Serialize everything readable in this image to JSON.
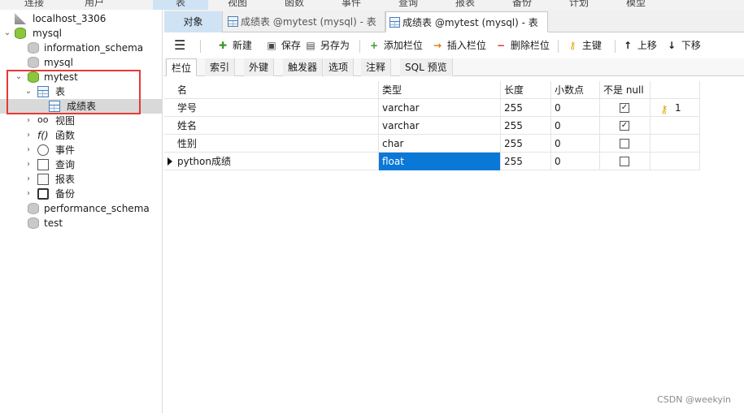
{
  "menu": [
    "连接",
    "用户",
    "表",
    "视图",
    "函数",
    "事件",
    "查询",
    "报表",
    "备份",
    "计划",
    "模型"
  ],
  "tree": {
    "server": "localhost_3306",
    "databases": [
      {
        "name": "mysql"
      },
      {
        "name": "information_schema"
      },
      {
        "name": "mysql"
      },
      {
        "name": "mytest"
      },
      {
        "name": "表"
      },
      {
        "name": "成绩表"
      },
      {
        "name": "视图"
      },
      {
        "name": "函数"
      },
      {
        "name": "事件"
      },
      {
        "name": "查询"
      },
      {
        "name": "报表"
      },
      {
        "name": "备份"
      },
      {
        "name": "performance_schema"
      },
      {
        "name": "test"
      }
    ]
  },
  "tabs": {
    "object": "对象",
    "tab1": "成绩表 @mytest (mysql) - 表",
    "tab2": "成绩表 @mytest (mysql) - 表"
  },
  "toolbar": {
    "new": "新建",
    "save": "保存",
    "save_as": "另存为",
    "add_field": "添加栏位",
    "insert_field": "插入栏位",
    "delete_field": "删除栏位",
    "primary_key": "主键",
    "move_up": "上移",
    "move_down": "下移"
  },
  "subtabs": [
    "栏位",
    "索引",
    "外键",
    "触发器",
    "选项",
    "注释",
    "SQL 预览"
  ],
  "grid": {
    "headers": [
      "名",
      "类型",
      "长度",
      "小数点",
      "不是 null",
      ""
    ],
    "rows": [
      {
        "name": "学号",
        "type": "varchar",
        "length": "255",
        "decimals": "0",
        "not_null": true,
        "key": "1"
      },
      {
        "name": "姓名",
        "type": "varchar",
        "length": "255",
        "decimals": "0",
        "not_null": true,
        "key": ""
      },
      {
        "name": "性别",
        "type": "char",
        "length": "255",
        "decimals": "0",
        "not_null": false,
        "key": ""
      },
      {
        "name": "python成绩",
        "type": "float",
        "length": "255",
        "decimals": "0",
        "not_null": false,
        "key": ""
      }
    ]
  },
  "watermark": "CSDN @weekyin",
  "colors": {
    "accent": "#0a78d7",
    "highlight_box": "#e53935",
    "tab_active_bg": "#cfe3f5"
  }
}
